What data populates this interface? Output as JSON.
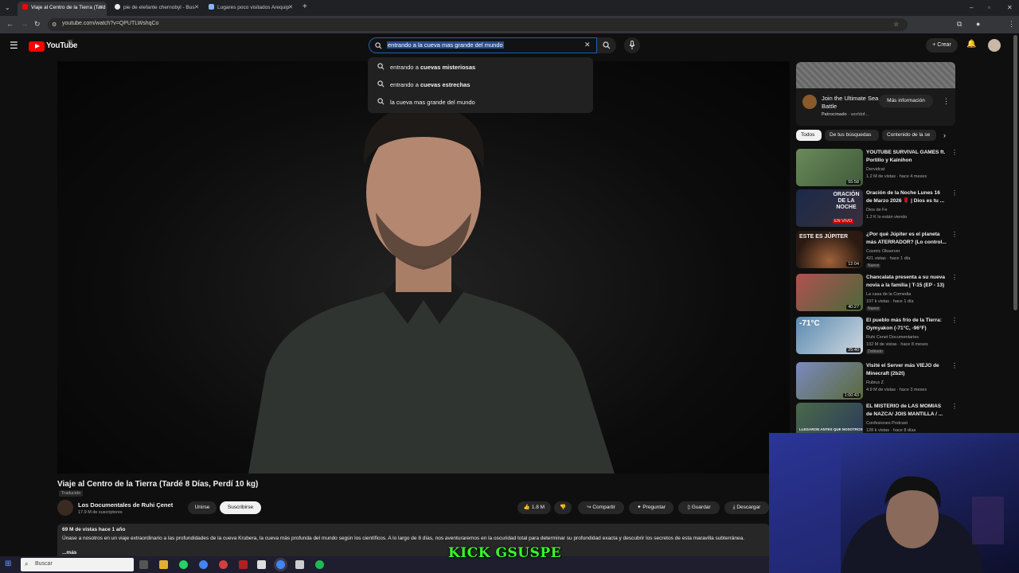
{
  "browser": {
    "tabs": [
      {
        "label": "Viaje al Centro de la Tierra (Tard",
        "active": true,
        "color": "#ff0000"
      },
      {
        "label": "pie de elefante chernobyl - Bus",
        "active": false,
        "color": "#e8eaed"
      },
      {
        "label": "Lugares poco visitados Arequip",
        "active": false,
        "color": "#8ab4f8"
      }
    ],
    "url": "youtube.com/watch?v=QPUTLWshqCo"
  },
  "youtube": {
    "logo_text": "YouTube",
    "country_code": "PE",
    "search_query": "entrando a la cueva mas grande del mundo",
    "create_label": "Crear",
    "suggestions": [
      {
        "prefix": "entrando a ",
        "bold": "cuevas misteriosas"
      },
      {
        "prefix": "entrando a ",
        "bold": "cuevas estrechas"
      },
      {
        "prefix": "la cueva mas grande del mundo",
        "bold": ""
      }
    ]
  },
  "video": {
    "title": "Viaje al Centro de la Tierra (Tardé 8 Días, Perdí 10 kg)",
    "translated_label": "Traducido",
    "channel_name": "Los Documentales de Ruhi Çenet",
    "subscribers": "17.9 M de suscriptores",
    "join_label": "Unirse",
    "subscribe_label": "Suscribirse",
    "likes": "1.8 M",
    "share_label": "Compartir",
    "ask_label": "Preguntar",
    "save_label": "Guardar",
    "download_label": "Descargar",
    "views_line": "69 M de vistas  hace 1 año",
    "description": "Únase a nosotros en un viaje extraordinario a las profundidades de la cueva Krubera, la cueva más profunda del mundo según los científicos. A lo largo de 8 días, nos aventuraremos en la oscuridad total para determinar su profundidad exacta y descubrir los secretos de esta maravilla subterránea.",
    "more_label": "...más"
  },
  "ad": {
    "title": "Join the Ultimate Sea Battle",
    "sponsored": "Patrocinado",
    "domain": "worldof...",
    "cta": "Más información"
  },
  "chips": [
    "Todos",
    "De tus búsquedas",
    "Contenido de la se"
  ],
  "recommendations": [
    {
      "title": "YOUTUBE SURVIVAL GAMES ft. Portillo y Kainihon",
      "channel": "Dervidcat",
      "meta": "1.2 M de vistas · hace 4 meses",
      "duration": "55:58",
      "badge": "",
      "thumb": "#5d7a4a"
    },
    {
      "title": "Oración de la Noche Lunes 16 de Marzo 2026 🌹 | Dios es tu ...",
      "channel": "Dios de Fe",
      "meta": "1.2 K lo están viendo",
      "duration": "",
      "badge": "",
      "thumb": "#1d2b4a",
      "thumb_text": "ORACIÓN DE LA NOCHE",
      "live": "EN VIVO"
    },
    {
      "title": "¿Por qué Júpiter es el planeta más ATERRADOR? (Lo control...",
      "channel": "Cosmic Observer",
      "meta": "421 vistas · hace 1 día",
      "duration": "12:04",
      "badge": "Nuevo",
      "thumb": "#3a2a1e",
      "thumb_text": "ESTE ES JÚPITER"
    },
    {
      "title": "Chancalata presenta a su nueva novia a la familia | T-15 (EP - 13)",
      "channel": "La casa de la Comedia",
      "meta": "107 k vistas · hace 1 día",
      "duration": "40:27",
      "badge": "Nuevo",
      "thumb": "#8a3a3a"
    },
    {
      "title": "El pueblo más frío de la Tierra: Oymyakon (-71°C, -96°F)",
      "channel": "Ruhi Cenet Documentaries",
      "meta": "102 M de vistas · hace 8 meses",
      "duration": "25:40",
      "badge": "Doblado",
      "thumb": "#4a7aa0",
      "thumb_text": "-71°C"
    },
    {
      "title": "Visité el Server más VIEJO de Minecraft (2b2t)",
      "channel": "Rubius Z",
      "meta": "4.9 M de vistas · hace 3 meses",
      "duration": "1:00:43",
      "badge": "",
      "thumb": "#5a6a9a"
    },
    {
      "title": "EL MISTERIO de LAS MOMIAS de NAZCA/ JOIS MANTILLA / ...",
      "channel": "Confesiones Podcast",
      "meta": "128 k vistas · hace 8 días",
      "duration": "",
      "badge": "",
      "thumb": "#3a5a3a",
      "thumb_text": "LLEGARON ANTES QUE NOSOTROS"
    }
  ],
  "taskbar": {
    "search_placeholder": "Buscar"
  },
  "overlay": {
    "kick_text": "KICK GSUSPE"
  }
}
